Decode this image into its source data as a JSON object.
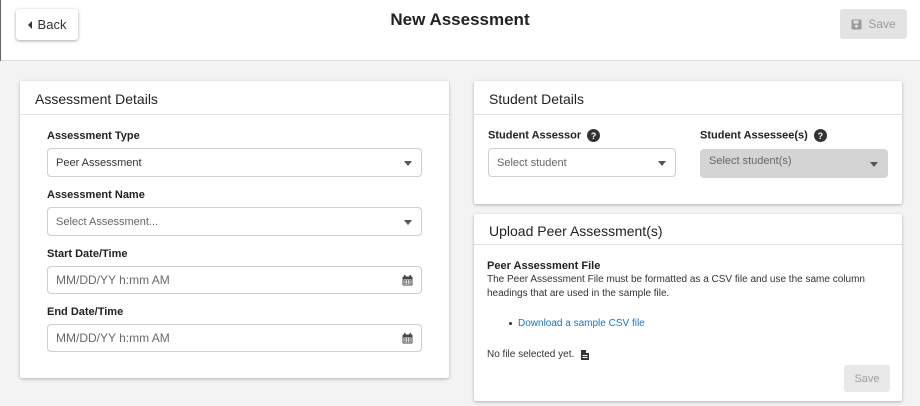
{
  "header": {
    "back_label": "Back",
    "title": "New Assessment",
    "save_label": "Save"
  },
  "assessment_details": {
    "heading": "Assessment Details",
    "type_label": "Assessment Type",
    "type_value": "Peer Assessment",
    "name_label": "Assessment Name",
    "name_placeholder": "Select Assessment...",
    "start_label": "Start Date/Time",
    "start_placeholder": "MM/DD/YY h:mm AM",
    "end_label": "End Date/Time",
    "end_placeholder": "MM/DD/YY h:mm AM"
  },
  "student_details": {
    "heading": "Student Details",
    "assessor_label": "Student Assessor",
    "assessor_placeholder": "Select student",
    "assessee_label": "Student Assessee(s)",
    "assessee_placeholder": "Select student(s)",
    "help_glyph": "?"
  },
  "upload": {
    "heading": "Upload Peer Assessment(s)",
    "file_label": "Peer Assessment File",
    "description": "The Peer Assessment File must be formatted as a CSV file and use the same column headings that are used in the sample file.",
    "download_link": "Download a sample CSV file",
    "no_file": "No file selected yet.",
    "save_label": "Save"
  }
}
